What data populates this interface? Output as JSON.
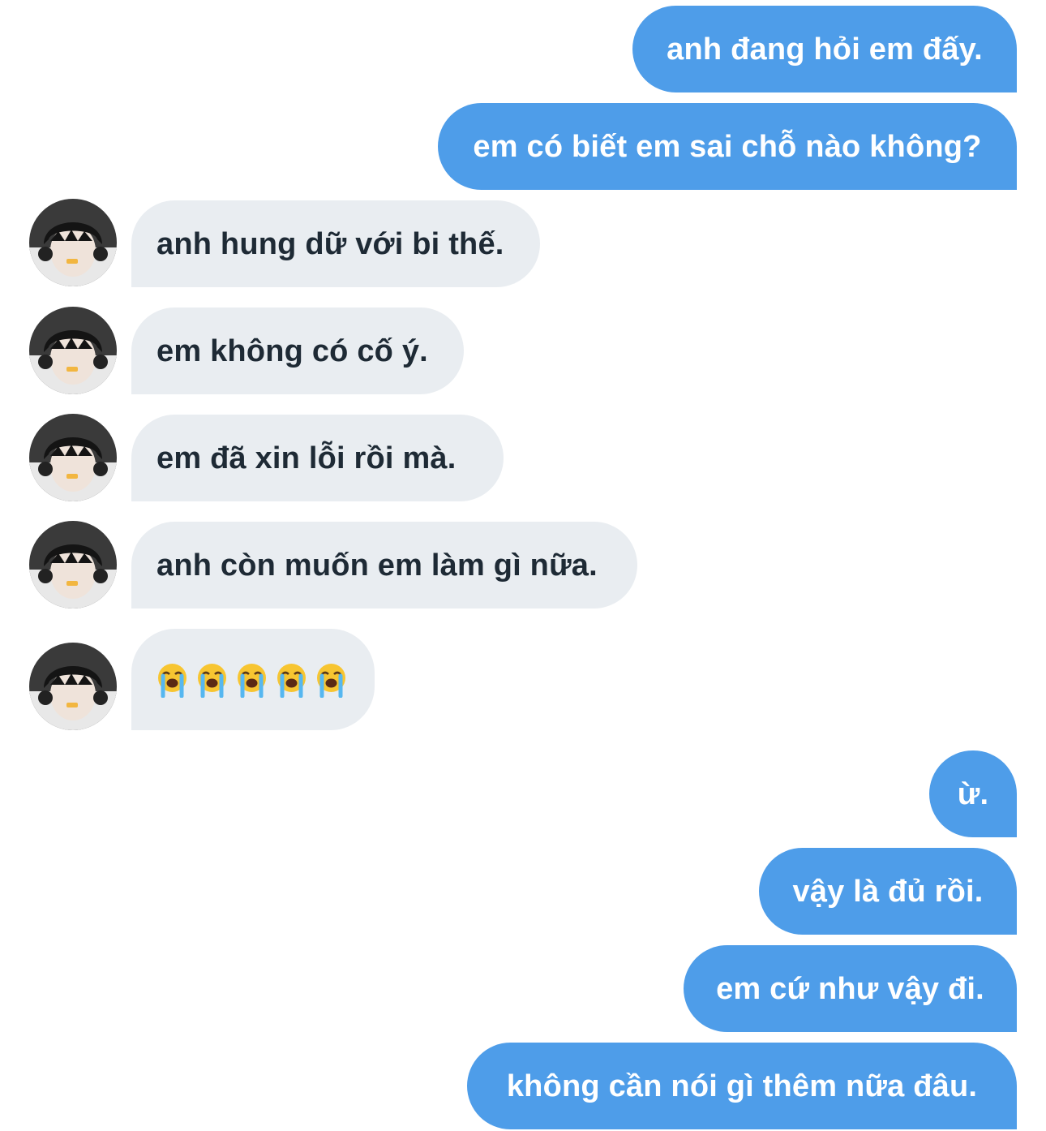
{
  "colors": {
    "sent_bubble": "#4e9de9",
    "received_bubble": "#e9edf1",
    "sent_text": "#ffffff",
    "received_text": "#1e2a35"
  },
  "messages": [
    {
      "sender": "me",
      "text": "anh đang hỏi em đấy."
    },
    {
      "sender": "me",
      "text": "em có biết em sai chỗ nào không?"
    },
    {
      "sender": "contact",
      "text": "anh hung dữ với bi thế."
    },
    {
      "sender": "contact",
      "text": "em không có cố ý."
    },
    {
      "sender": "contact",
      "text": "em đã xin lỗi rồi mà."
    },
    {
      "sender": "contact",
      "text": "anh còn muốn em làm gì nữa."
    },
    {
      "sender": "contact",
      "emoji": "loudly-crying-face",
      "emoji_count": 5
    },
    {
      "sender": "me",
      "text": "ừ."
    },
    {
      "sender": "me",
      "text": "vậy là đủ rồi."
    },
    {
      "sender": "me",
      "text": "em cứ như vậy đi."
    },
    {
      "sender": "me",
      "text": "không cần nói gì thêm nữa đâu."
    }
  ]
}
